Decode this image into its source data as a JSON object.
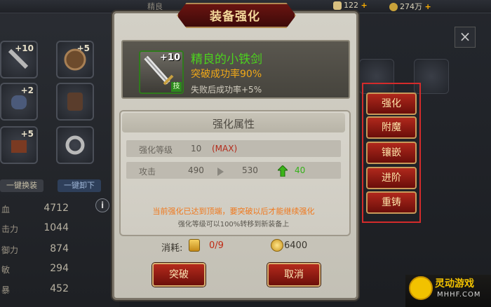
{
  "dialog": {
    "title": "装备强化",
    "item": {
      "plus_label": "+10",
      "badge": "技",
      "name": "精良的小铁剑",
      "break_rate": "突破成功率90%",
      "fail_rate": "失败后成功率+5%"
    },
    "attributes": {
      "title": "强化属性",
      "level_label": "强化等级",
      "level_value": "10",
      "level_max": "(MAX)",
      "attack_label": "攻击",
      "attack_current": "490",
      "attack_next": "530",
      "attack_gain": "40"
    },
    "notice": "当前强化已达到顶端，要突破以后才能继续强化",
    "subnote": "强化等级可以100%转移到新装备上",
    "cost": {
      "label": "消耗:",
      "stone_value": "0/9",
      "gold_value": "6400"
    },
    "buttons": {
      "breakthrough": "突破",
      "cancel": "取消"
    }
  },
  "side_menu": [
    "强化",
    "附魔",
    "镶嵌",
    "进阶",
    "重铸"
  ],
  "background": {
    "top_title": "精良",
    "resources": [
      {
        "value": "122"
      },
      {
        "value": "274万"
      }
    ],
    "inventory_levels": [
      "+10",
      "+5",
      "+2",
      "",
      "+5",
      ""
    ],
    "buttons": [
      "一键换装",
      "一键卸下"
    ],
    "stats": [
      {
        "label": "血",
        "value": "4712"
      },
      {
        "label": "击力",
        "value": "1044"
      },
      {
        "label": "御力",
        "value": "874"
      },
      {
        "label": "敏",
        "value": "294"
      },
      {
        "label": "暴",
        "value": "452"
      }
    ],
    "info_icon": "i",
    "close_icon": "×"
  },
  "watermark": {
    "name": "灵动游戏",
    "url": "MHHF.COM"
  },
  "colors": {
    "title_red": "#6a1411",
    "gold_text": "#f3d79a",
    "item_green": "#4cd21e",
    "rate_orange": "#f0a818",
    "highlight_border": "#d42b2b"
  }
}
